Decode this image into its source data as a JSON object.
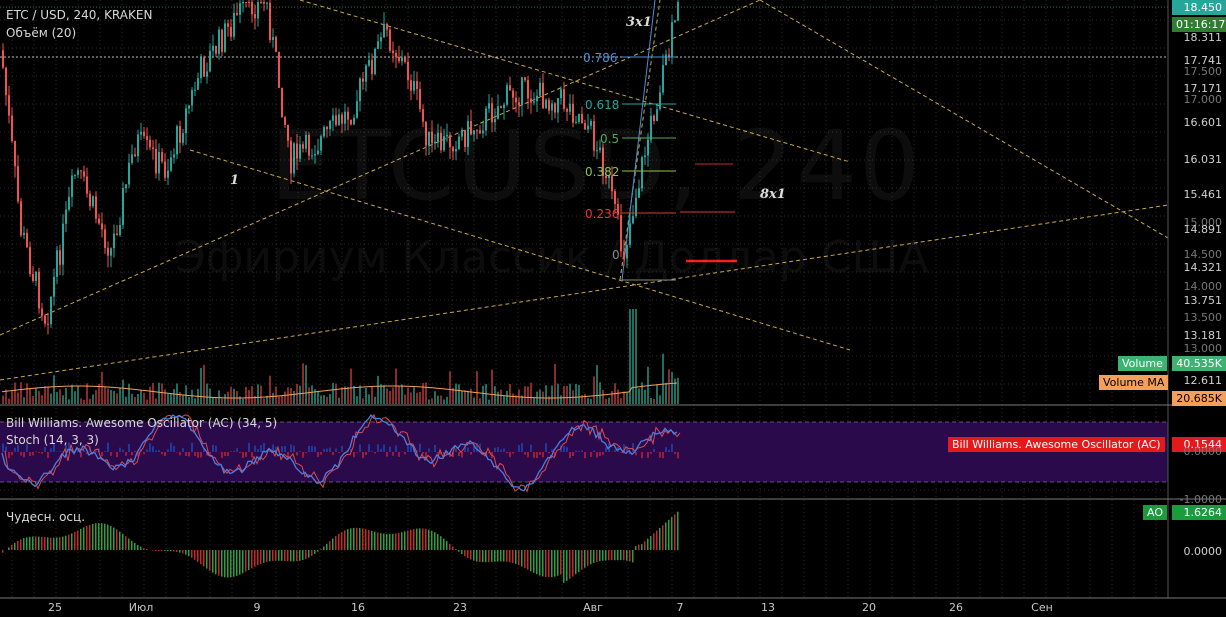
{
  "header": {
    "symbol": "ETC / USD, 240, KRAKEN",
    "volume_study": "Объём (20)",
    "watermark_symbol": "ETCUSD, 240",
    "watermark_name": "Эфириум Классик / Доллар США"
  },
  "price_axis": {
    "ticks": [
      "18.311",
      "17.741",
      "17.500",
      "17.171",
      "17.000",
      "16.601",
      "16.031",
      "15.461",
      "15.000",
      "14.891",
      "14.500",
      "14.321",
      "14.000",
      "13.751",
      "13.500",
      "13.181",
      "13.000",
      "12.611"
    ],
    "last_price": "18.450",
    "countdown": "01:16:17",
    "volume_label": "Volume",
    "volume_value": "40.535K",
    "volume_ma_label": "Volume MA",
    "volume_ma_value": "20.685K"
  },
  "fibonacci": {
    "levels": [
      "0.786",
      "0.618",
      "0.5",
      "0.382",
      "0.236",
      "0"
    ]
  },
  "annotations": {
    "gann_1": "1",
    "gann_3x1": "3x1",
    "gann_8x1": "8x1"
  },
  "oscillator_pane": {
    "title_ac": "Bill Williams. Awesome Oscillator (AC) (34, 5)",
    "title_stoch": "Stoch (14, 3, 3)",
    "tag_label": "Bill Williams. Awesome Oscillator (AC)",
    "tag_value": "0.1544",
    "ticks": [
      "0.0000",
      "-1.0000"
    ]
  },
  "ao_pane": {
    "title": "Чудесн. осц.",
    "tag_label": "AO",
    "tag_value": "1.6264",
    "ticks": [
      "0.0000"
    ]
  },
  "time_axis": {
    "labels": [
      "25",
      "Июл",
      "9",
      "16",
      "23",
      "Авг",
      "7",
      "13",
      "20",
      "26",
      "Сен"
    ]
  },
  "colors": {
    "background": "#000000",
    "up": "#26a69a",
    "down": "#ef5350",
    "grid": "#2a2a2a",
    "trendline": "#c8a84b",
    "volume_tag": "#3cb371",
    "volume_ma_tag": "#f5a05a",
    "ac_tag": "#e5191c",
    "ao_tag": "#1a9b3c",
    "price_tag": "#2e7d32",
    "stoch_k": "#4a7fe0",
    "stoch_d": "#e04a4a",
    "stoch_band": "#2a0a4a"
  }
}
